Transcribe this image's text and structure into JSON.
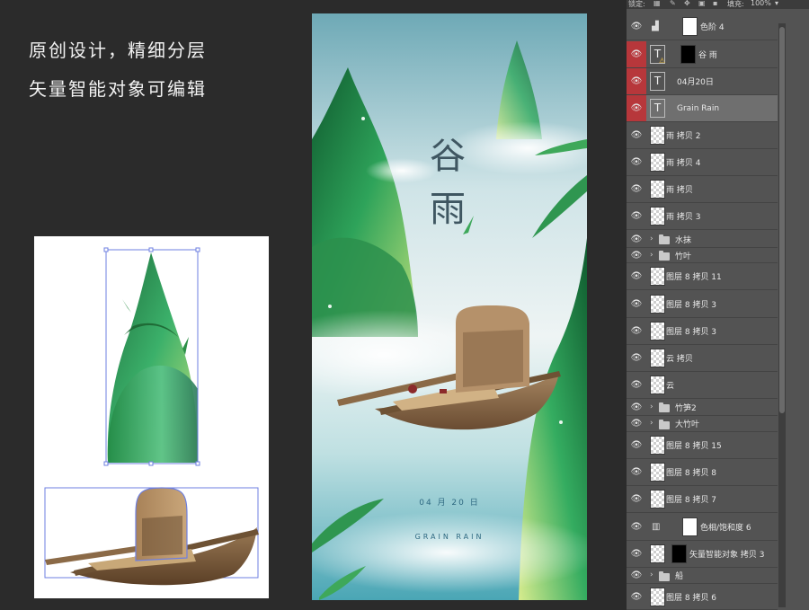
{
  "headlines": {
    "line1": "原创设计，精细分层",
    "line2": "矢量智能对象可编辑"
  },
  "poster": {
    "title_char1": "谷",
    "title_char2": "雨",
    "date": "04 月 20 日",
    "subtitle": "GRAIN RAIN"
  },
  "panel": {
    "lock_label": "锁定:",
    "fill_label": "填充:",
    "fill_value": "100%",
    "layers": [
      {
        "name": "色阶 4",
        "kind": "adjust",
        "selected": false,
        "red": false
      },
      {
        "name": "谷 雨",
        "kind": "text-mask",
        "selected": false,
        "red": true
      },
      {
        "name": "04月20日",
        "kind": "text",
        "selected": false,
        "red": true
      },
      {
        "name": "Grain Rain",
        "kind": "text",
        "selected": true,
        "red": true
      },
      {
        "name": "雨 拷贝 2",
        "kind": "pixel",
        "selected": false,
        "red": false
      },
      {
        "name": "雨 拷贝 4",
        "kind": "pixel",
        "selected": false,
        "red": false
      },
      {
        "name": "雨 拷贝",
        "kind": "pixel",
        "selected": false,
        "red": false
      },
      {
        "name": "雨 拷贝 3",
        "kind": "pixel",
        "selected": false,
        "red": false
      },
      {
        "name": "水抹",
        "kind": "folder",
        "selected": false,
        "red": false
      },
      {
        "name": "竹叶",
        "kind": "folder",
        "selected": false,
        "red": false
      },
      {
        "name": "图层 8 拷贝 11",
        "kind": "pixel",
        "selected": false,
        "red": false
      },
      {
        "name": "图层 8 拷贝 3",
        "kind": "pixel",
        "selected": false,
        "red": false
      },
      {
        "name": "图层 8 拷贝 3",
        "kind": "pixel",
        "selected": false,
        "red": false
      },
      {
        "name": "云 拷贝",
        "kind": "smart",
        "selected": false,
        "red": false
      },
      {
        "name": "云",
        "kind": "smart",
        "selected": false,
        "red": false
      },
      {
        "name": "竹笋2",
        "kind": "folder",
        "selected": false,
        "red": false
      },
      {
        "name": "大竹叶",
        "kind": "folder",
        "selected": false,
        "red": false
      },
      {
        "name": "图层 8 拷贝 15",
        "kind": "pixel",
        "selected": false,
        "red": false
      },
      {
        "name": "图层 8 拷贝 8",
        "kind": "pixel",
        "selected": false,
        "red": false
      },
      {
        "name": "图层 8 拷贝 7",
        "kind": "pixel",
        "selected": false,
        "red": false
      },
      {
        "name": "色相/饱和度 6",
        "kind": "adjust",
        "selected": false,
        "red": false
      },
      {
        "name": "矢量智能对象 拷贝 3",
        "kind": "smart-mask",
        "selected": false,
        "red": false
      },
      {
        "name": "船",
        "kind": "folder",
        "selected": false,
        "red": false
      },
      {
        "name": "图层 8 拷贝 6",
        "kind": "pixel",
        "selected": false,
        "red": false
      }
    ]
  },
  "colors": {
    "background": "#2b2b2b",
    "panel": "#535353",
    "selected_row": "#6f6f6f",
    "visibility_red": "#b7373b",
    "bamboo_green": "#3aa85a",
    "poster_sky": "#8fc6cf"
  }
}
